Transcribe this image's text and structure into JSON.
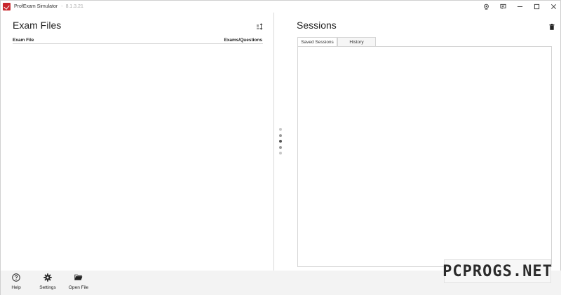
{
  "app": {
    "title": "ProfExam Simulator",
    "separator": "-",
    "version": "8.1.3.21",
    "logo_color": "#c8262c"
  },
  "titlebar_icons": [
    "webcam-icon",
    "feedback-icon",
    "minimize-icon",
    "maximize-icon",
    "close-icon"
  ],
  "exam_files": {
    "title": "Exam Files",
    "columns": [
      "Exam File",
      "Exams/Questions"
    ],
    "rows": []
  },
  "sessions": {
    "title": "Sessions",
    "tabs": [
      {
        "label": "Saved Sessions",
        "active": true
      },
      {
        "label": "History",
        "active": false
      }
    ],
    "items": []
  },
  "bottom_bar": {
    "help_label": "Help",
    "settings_label": "Settings",
    "open_file_label": "Open File"
  },
  "watermark": {
    "text": "PCPROGS.NET"
  }
}
